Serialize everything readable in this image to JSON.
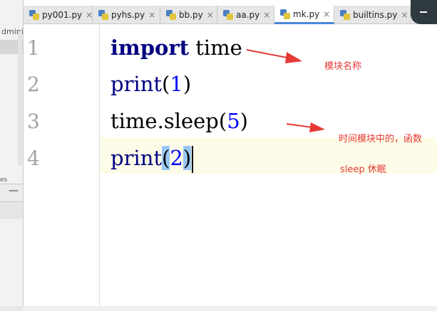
{
  "project_pane": {
    "partial_text": "dmini",
    "fragment_text": "es"
  },
  "tabs": [
    {
      "label": "py001.py",
      "active": false
    },
    {
      "label": "pyhs.py",
      "active": false
    },
    {
      "label": "bb.py",
      "active": false
    },
    {
      "label": "aa.py",
      "active": false
    },
    {
      "label": "mk.py",
      "active": true
    },
    {
      "label": "builtins.py",
      "active": false
    }
  ],
  "tab_close_glyph": "×",
  "editor": {
    "line_numbers": [
      "1",
      "2",
      "3",
      "4"
    ],
    "lines": [
      {
        "kw": "import",
        "rest": " time"
      },
      {
        "fn": "print",
        "open": "(",
        "arg": "1",
        "close": ")"
      },
      {
        "obj": "time.",
        "fn": "sleep",
        "open": "(",
        "arg": "5",
        "close": ")"
      },
      {
        "fn": "print",
        "open": "(",
        "arg": "2",
        "close": ")"
      }
    ],
    "current_line": 4
  },
  "annotations": {
    "module_name": "模块名称",
    "function_in_module": "时间模块中的，函数",
    "sleep_note": "sleep  休眠"
  },
  "colors": {
    "keyword": "#000080",
    "number": "#0000ff",
    "annotation": "#e53935",
    "current_line_bg": "#fdfce8",
    "brace_highlight": "#99c7f5"
  }
}
